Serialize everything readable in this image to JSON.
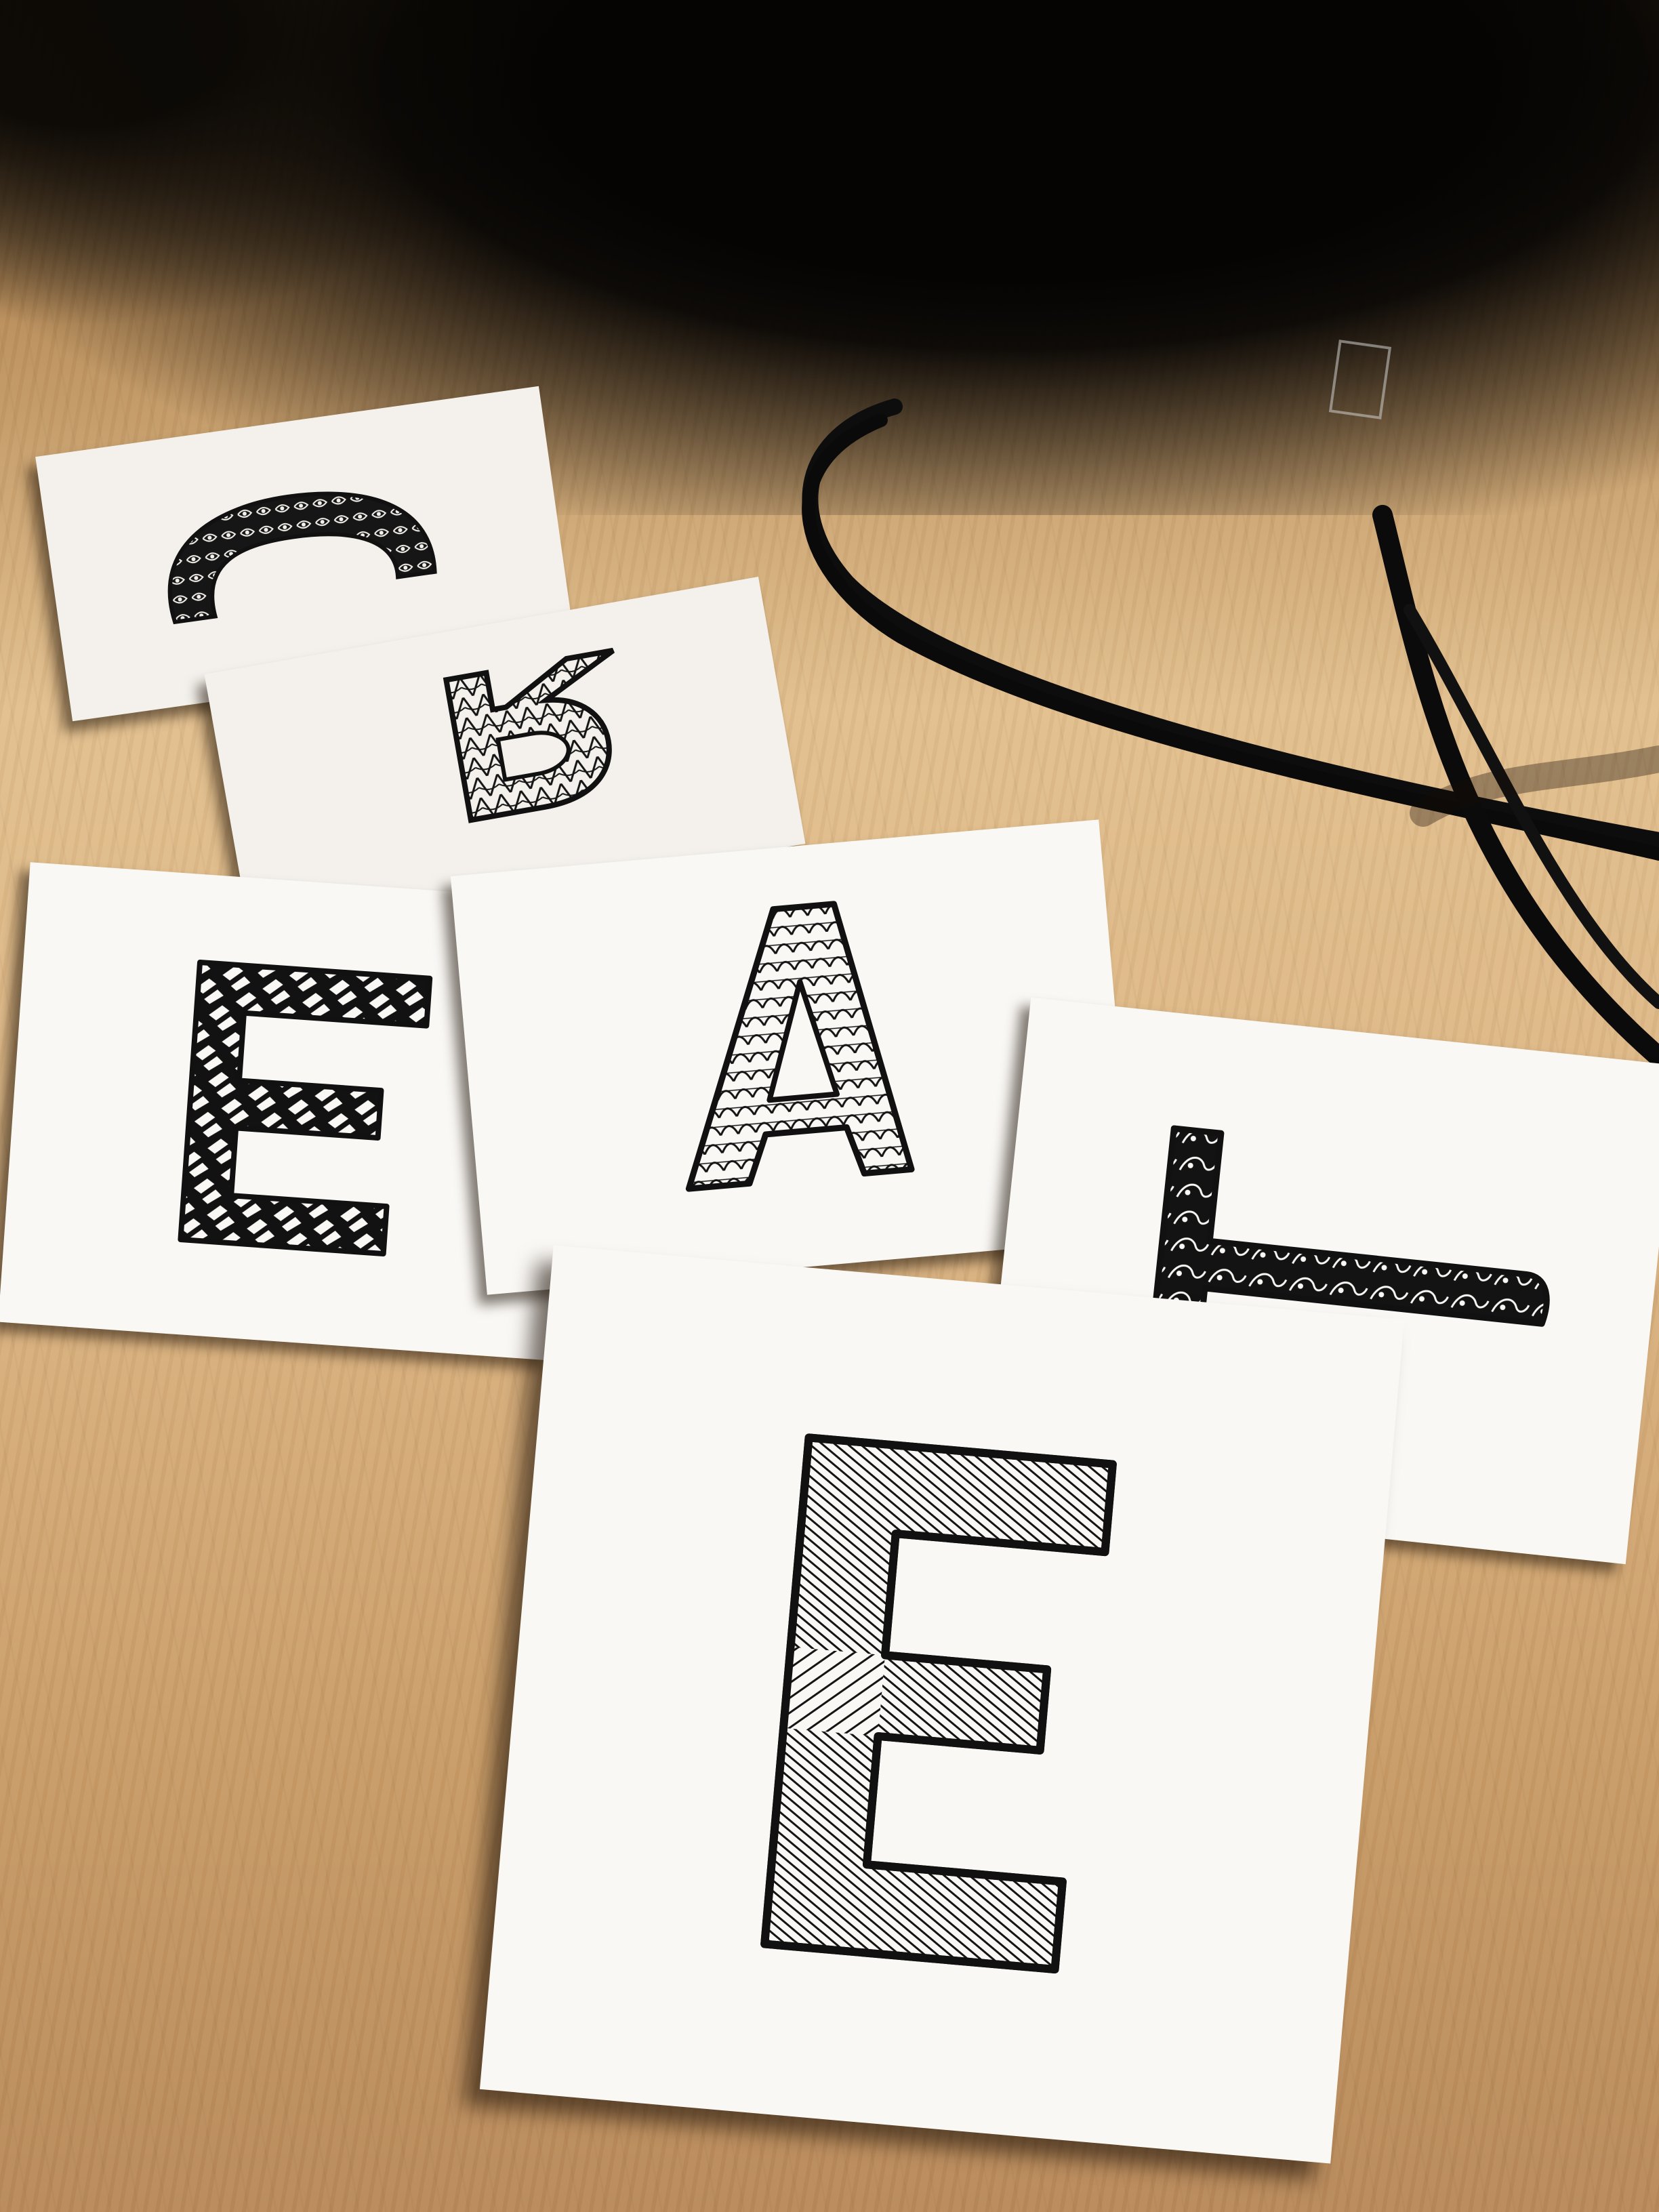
{
  "colors": {
    "desk": "#dcb584",
    "card": "#f4f1ec",
    "ink": "#141414",
    "background_shadow": "#050403"
  },
  "letters": [
    "C",
    "R",
    "E",
    "A",
    "T",
    "E"
  ]
}
